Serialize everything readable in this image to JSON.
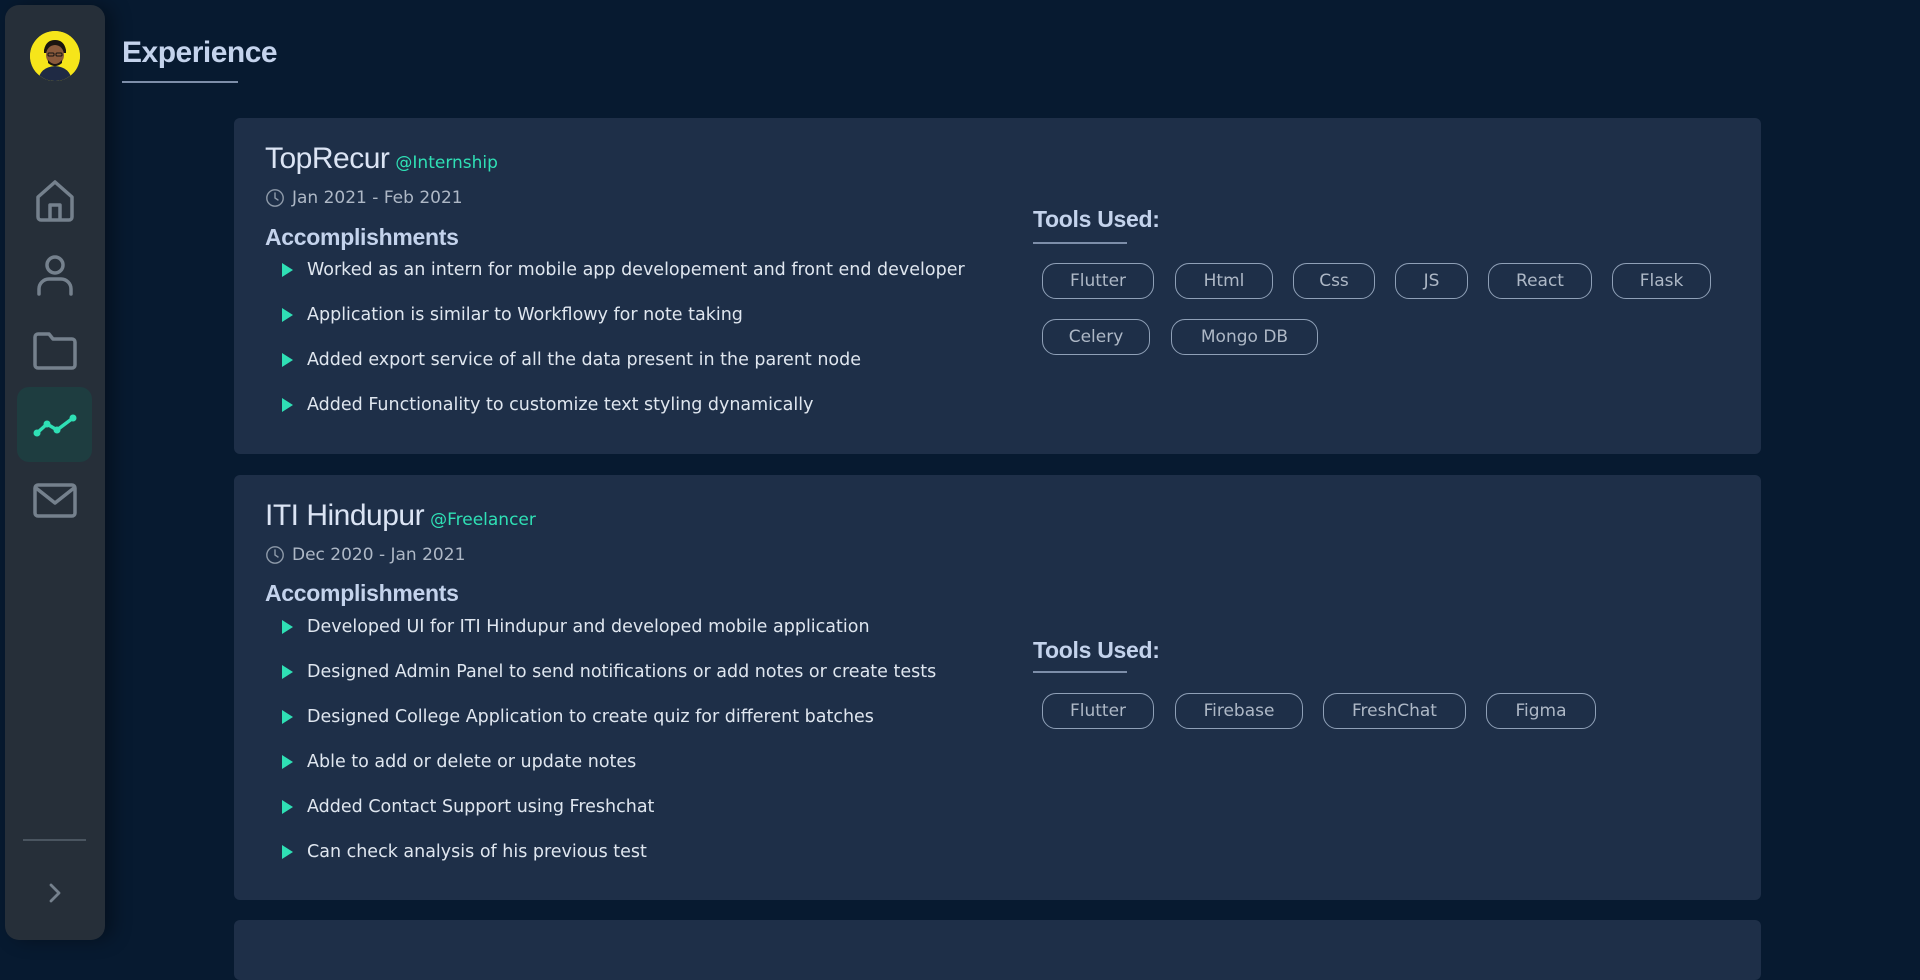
{
  "page": {
    "title": "Experience"
  },
  "nav": {
    "items": [
      {
        "name": "home",
        "active": false
      },
      {
        "name": "about",
        "active": false
      },
      {
        "name": "projects",
        "active": false
      },
      {
        "name": "experience",
        "active": true
      },
      {
        "name": "contact",
        "active": false
      }
    ],
    "accent_color": "#2fe0b5"
  },
  "experiences": [
    {
      "company": "TopRecur",
      "role": "@Internship",
      "dates": "Jan 2021 - Feb 2021",
      "accomplishments_heading": "Accomplishments",
      "accomplishments": [
        "Worked as an intern for mobile app developement and front end developer",
        "Application is similar to Workflowy for note taking",
        "Added export service of all the data present in the parent node",
        "Added Functionality to customize text styling dynamically"
      ],
      "tools_heading": "Tools Used:",
      "tools": [
        "Flutter",
        "Html",
        "Css",
        "JS",
        "React",
        "Flask",
        "Celery",
        "Mongo DB"
      ]
    },
    {
      "company": "ITI Hindupur",
      "role": "@Freelancer",
      "dates": "Dec 2020 - Jan 2021",
      "accomplishments_heading": "Accomplishments",
      "accomplishments": [
        "Developed UI for ITI Hindupur and developed mobile application",
        "Designed Admin Panel to send notifications or add notes or create tests",
        "Designed College Application to create quiz for different batches",
        "Able to add or delete or update notes",
        "Added Contact Support using Freshchat",
        "Can check analysis of his previous test"
      ],
      "tools_heading": "Tools Used:",
      "tools": [
        "Flutter",
        "Firebase",
        "FreshChat",
        "Figma"
      ]
    }
  ]
}
